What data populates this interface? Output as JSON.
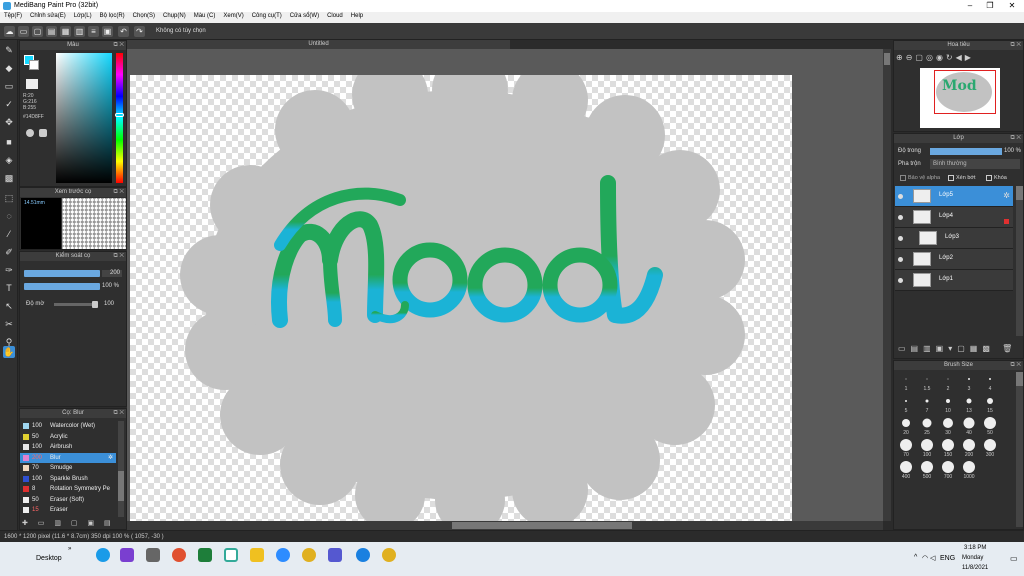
{
  "window": {
    "title": "MediBang Paint Pro (32bit)",
    "minimize": "–",
    "maximize": "❐",
    "close": "✕"
  },
  "menu": [
    "Tệp(F)",
    "Chỉnh sửa(E)",
    "Lớp(L)",
    "Bộ lọc(R)",
    "Chọn(S)",
    "Chụp(N)",
    "Màu (C)",
    "Xem(V)",
    "Công cụ(T)",
    "Cửa sổ(W)",
    "Cloud",
    "Help"
  ],
  "toolbar": {
    "option_text": "Không có tùy chọn",
    "undo_icon": "undo-icon",
    "redo_icon": "redo-icon"
  },
  "document": {
    "tab_title": "Untitled",
    "artwork_text": "Mod",
    "accent": "#22a85a",
    "accent2": "#1bb3d6",
    "blob": "#c2c2c2"
  },
  "color_panel": {
    "title": "Màu",
    "r": "R:20",
    "g": "G:216",
    "b": "B:255",
    "hex": "#14D8FF",
    "primary": "#14D8FF"
  },
  "preview_panel": {
    "title": "Xem trước cọ",
    "size": "14.51mm"
  },
  "brush_control": {
    "title": "Kiểm soát cọ",
    "size_value": "200",
    "opacity_value": "100 %",
    "smooth_label": "Độ mờ",
    "smooth_value": "100"
  },
  "brush_list": {
    "title": "Cọ: Blur",
    "items": [
      {
        "n": "100",
        "name": "Watercolor (Wet)",
        "color": "#9fd6f0"
      },
      {
        "n": "50",
        "name": "Acrylic",
        "color": "#e0d030"
      },
      {
        "n": "100",
        "name": "Airbrush",
        "color": "#e8e8e8"
      },
      {
        "n": "200",
        "name": "Blur",
        "color": "#e080d0"
      },
      {
        "n": "70",
        "name": "Smudge",
        "color": "#f0d8c0"
      },
      {
        "n": "100",
        "name": "Sparkle Brush",
        "color": "#3050d0"
      },
      {
        "n": "8",
        "name": "Rotation Symmetry Pe",
        "color": "#e03030"
      },
      {
        "n": "50",
        "name": "Eraser (Soft)",
        "color": "#f0f0f0"
      },
      {
        "n": "15",
        "name": "Eraser",
        "color": "#f0f0f0"
      }
    ]
  },
  "navigator": {
    "title": "Hoa tiêu"
  },
  "layers_panel": {
    "title": "Lớp",
    "opacity_label": "Độ trong",
    "opacity_value": "100 %",
    "blend_label": "Pha trộn",
    "blend_value": "Bình thường",
    "protect_alpha": "Bảo vệ alpha",
    "clip": "Xén bớt",
    "lock": "Khóa",
    "layers": [
      "Lớp5",
      "Lớp4",
      "Lớp3",
      "Lớp2",
      "Lớp1"
    ]
  },
  "brush_size": {
    "title": "Brush Size",
    "sizes": [
      "1",
      "1.5",
      "2",
      "3",
      "4",
      "5",
      "7",
      "10",
      "13",
      "15",
      "20",
      "25",
      "30",
      "40",
      "50",
      "70",
      "100",
      "150",
      "200",
      "300",
      "400",
      "500",
      "700",
      "1000"
    ]
  },
  "status": {
    "text": "1600 * 1200 pixel   (11.6 * 8.7cm)   350 dpi   100 %   ( 1057, -30 )"
  },
  "taskbar": {
    "desktop": "Desktop",
    "lang": "ENG",
    "time": "3:18 PM",
    "day": "Monday",
    "date": "11/8/2021"
  }
}
